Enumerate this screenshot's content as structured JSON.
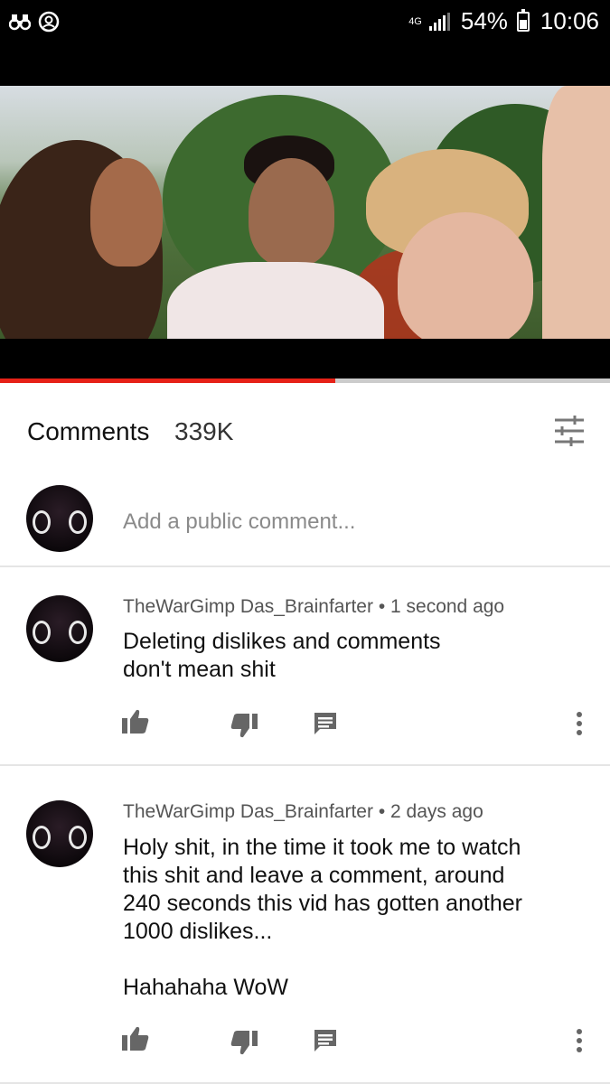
{
  "status_bar": {
    "network": "4G",
    "battery": "54%",
    "time": "10:06"
  },
  "video": {
    "progress": 0.55
  },
  "comments_header": {
    "title": "Comments",
    "count": "339K"
  },
  "add_comment": {
    "placeholder": "Add a public comment..."
  },
  "comments": [
    {
      "author": "TheWarGimp Das_Brainfarter",
      "time": "1 second ago",
      "text": "Deleting dislikes and comments\ndon't mean shit"
    },
    {
      "author": "TheWarGimp Das_Brainfarter",
      "time": "2 days ago",
      "text": "Holy shit, in the time it took me to watch\nthis shit and leave a comment, around\n240 seconds this vid has gotten another\n1000 dislikes...\n\nHahahaha WoW"
    }
  ],
  "colors": {
    "accent": "#e62117",
    "icon": "#666666"
  }
}
